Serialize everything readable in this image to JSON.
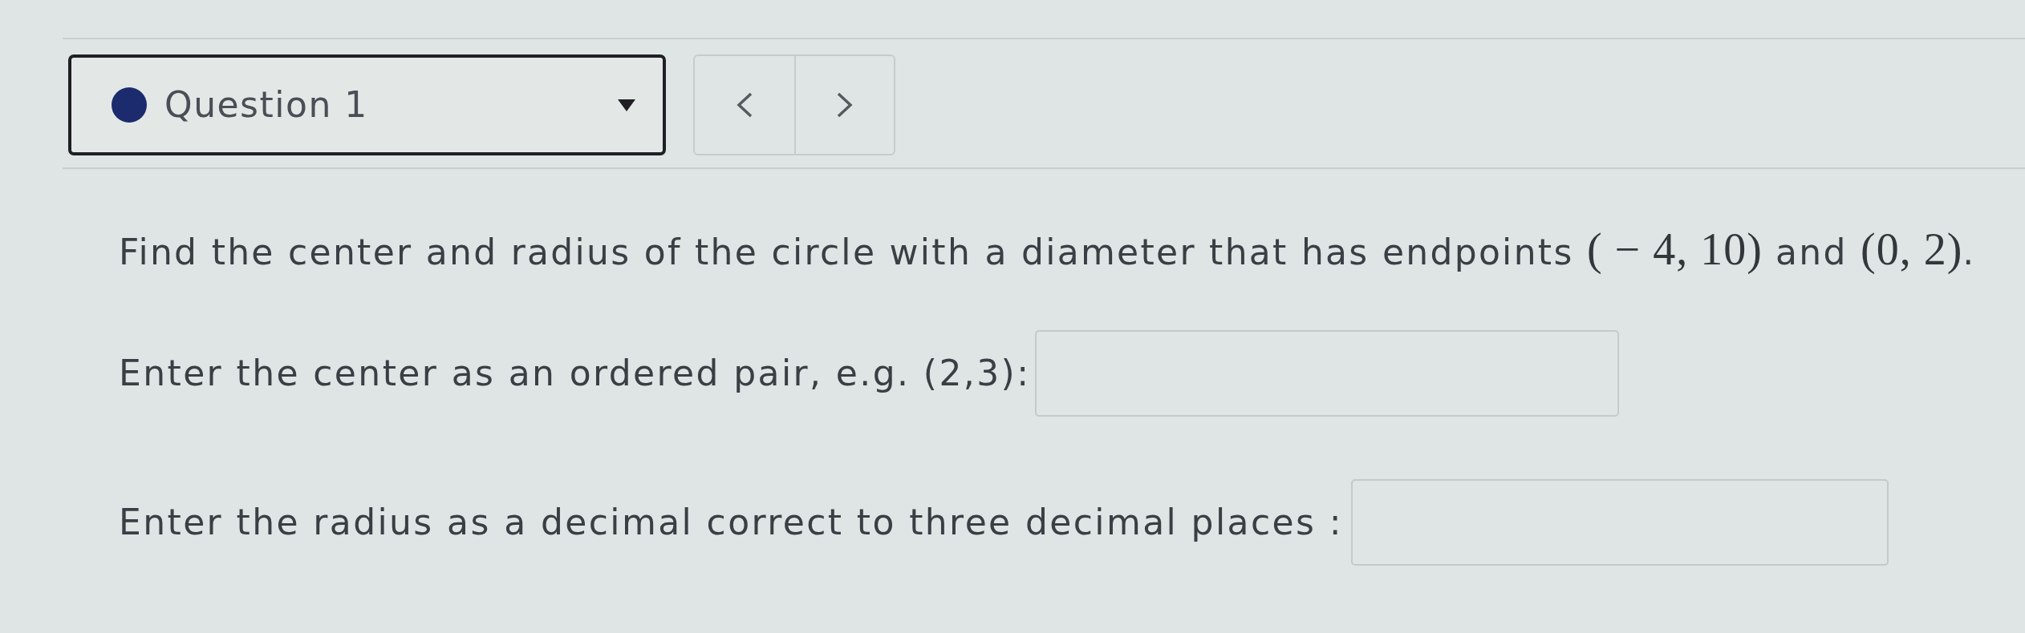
{
  "question_selector": {
    "label": "Question 1"
  },
  "prompt": [
    {
      "kind": "text",
      "text": "Find the center and radius of the circle with a diameter that has endpoints "
    },
    {
      "kind": "math",
      "text": "( − 4, 10)"
    },
    {
      "kind": "text",
      "text": " and "
    },
    {
      "kind": "math",
      "text": "(0, 2)"
    },
    {
      "kind": "text",
      "text": "."
    }
  ],
  "fields": [
    {
      "label": "Enter the center as an ordered pair, e.g. (2,3):"
    },
    {
      "label": "Enter the radius as a decimal correct to three decimal places :"
    }
  ]
}
